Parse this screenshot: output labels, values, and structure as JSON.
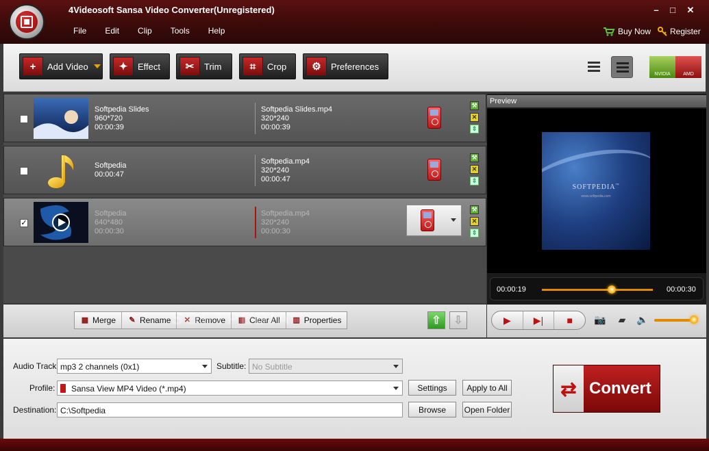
{
  "window": {
    "title": "4Videosoft Sansa Video Converter(Unregistered)",
    "controls": {
      "minimize": "–",
      "maximize": "□",
      "close": "✕"
    }
  },
  "menu": {
    "items": [
      "File",
      "Edit",
      "Clip",
      "Tools",
      "Help"
    ],
    "buy_now": "Buy Now",
    "register": "Register"
  },
  "toolbar": {
    "add_video": "Add Video",
    "effect": "Effect",
    "trim": "Trim",
    "crop": "Crop",
    "preferences": "Preferences",
    "gpu": {
      "nvidia": "NVIDIA",
      "amd": "AMD"
    }
  },
  "files": [
    {
      "name": "Softpedia Slides",
      "resolution": "960*720",
      "duration": "00:00:39",
      "output_name": "Softpedia Slides.mp4",
      "output_resolution": "320*240",
      "output_duration": "00:00:39",
      "checked": false
    },
    {
      "name": "Softpedia",
      "duration": "00:00:47",
      "output_name": "Softpedia.mp4",
      "output_resolution": "320*240",
      "output_duration": "00:00:47",
      "checked": false
    },
    {
      "name": "Softpedia",
      "resolution": "640*480",
      "duration": "00:00:30",
      "output_name": "Softpedia.mp4",
      "output_resolution": "320*240",
      "output_duration": "00:00:30",
      "checked": true
    }
  ],
  "list_actions": {
    "merge": "Merge",
    "rename": "Rename",
    "remove": "Remove",
    "clear_all": "Clear All",
    "properties": "Properties"
  },
  "watermark": "SOFTPEDIA",
  "preview": {
    "label": "Preview",
    "video_text": "SOFTPEDIA",
    "video_trademark": "™",
    "video_sub": "www.softpedia.com",
    "current_time": "00:00:19",
    "total_time": "00:00:30",
    "progress": 0.63,
    "volume": 0.87
  },
  "settings": {
    "audio_track_label": "Audio Track:",
    "audio_track_value": "mp3 2 channels (0x1)",
    "subtitle_label": "Subtitle:",
    "subtitle_value": "No Subtitle",
    "profile_label": "Profile:",
    "profile_value": "Sansa View MP4 Video (*.mp4)",
    "settings_button": "Settings",
    "apply_to_all_button": "Apply to All",
    "destination_label": "Destination:",
    "destination_value": "C:\\Softpedia",
    "browse_button": "Browse",
    "open_folder_button": "Open Folder",
    "convert_button": "Convert"
  },
  "colors": {
    "brand_red": "#8a1010",
    "accent_orange": "#e08a00"
  }
}
